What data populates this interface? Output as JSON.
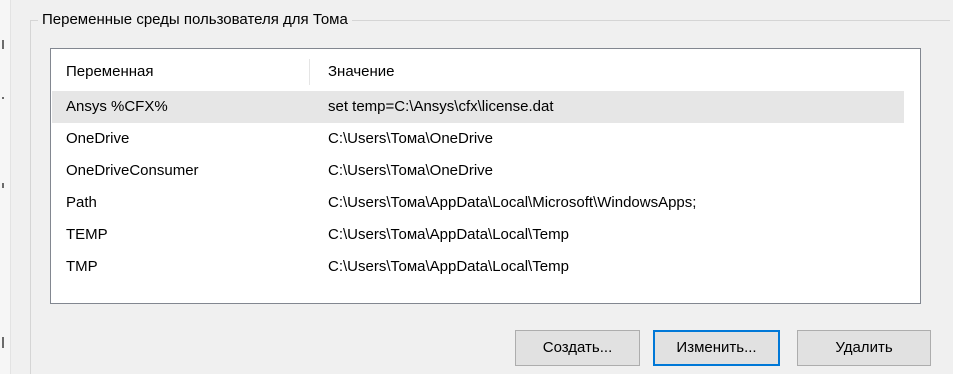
{
  "group": {
    "title": "Переменные среды пользователя для Тома"
  },
  "list": {
    "columns": [
      "Переменная",
      "Значение"
    ],
    "rows": [
      {
        "name": "Ansys %CFX%",
        "value": "set temp=C:\\Ansys\\cfx\\license.dat",
        "selected": true
      },
      {
        "name": "OneDrive",
        "value": "C:\\Users\\Тома\\OneDrive",
        "selected": false
      },
      {
        "name": "OneDriveConsumer",
        "value": "C:\\Users\\Тома\\OneDrive",
        "selected": false
      },
      {
        "name": "Path",
        "value": "C:\\Users\\Тома\\AppData\\Local\\Microsoft\\WindowsApps;",
        "selected": false
      },
      {
        "name": "TEMP",
        "value": "C:\\Users\\Тома\\AppData\\Local\\Temp",
        "selected": false
      },
      {
        "name": "TMP",
        "value": "C:\\Users\\Тома\\AppData\\Local\\Temp",
        "selected": false
      }
    ]
  },
  "buttons": {
    "create_label": "Создать...",
    "edit_label": "Изменить...",
    "delete_label": "Удалить"
  },
  "colors": {
    "window_bg": "#f0f0f0",
    "selected_row": "#e6e6e6",
    "default_button_border": "#0078d7"
  }
}
